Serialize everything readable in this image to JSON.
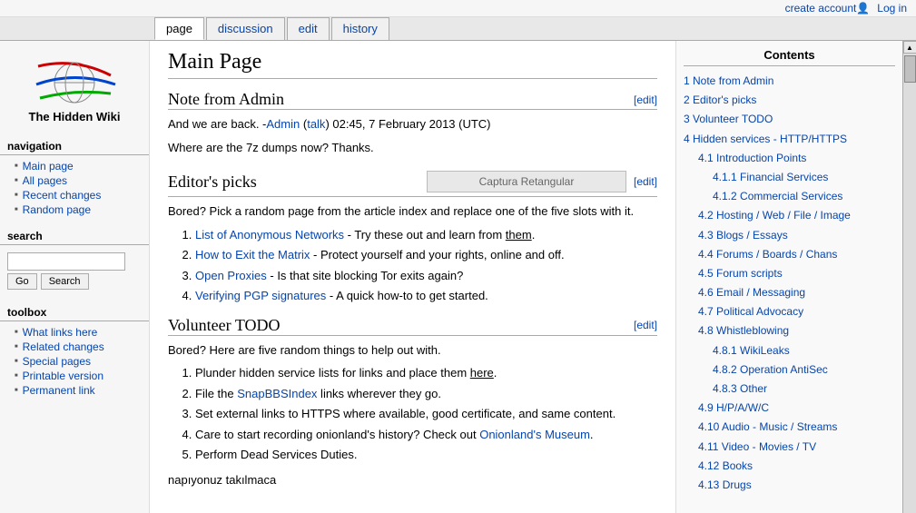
{
  "topbar": {
    "create_account": "create account",
    "login": "Log in"
  },
  "tabs": [
    {
      "id": "page",
      "label": "page",
      "active": true
    },
    {
      "id": "discussion",
      "label": "discussion",
      "active": false
    },
    {
      "id": "edit",
      "label": "edit",
      "active": false
    },
    {
      "id": "history",
      "label": "history",
      "active": false
    }
  ],
  "sidebar": {
    "logo_line1": "The Hidden Wiki",
    "nav_title": "navigation",
    "nav_links": [
      {
        "label": "Main page"
      },
      {
        "label": "All pages"
      },
      {
        "label": "Recent changes"
      },
      {
        "label": "Random page"
      }
    ],
    "search_title": "search",
    "search_placeholder": "",
    "go_label": "Go",
    "search_label": "Search",
    "toolbox_title": "toolbox",
    "toolbox_links": [
      {
        "label": "What links here"
      },
      {
        "label": "Related changes"
      },
      {
        "label": "Special pages"
      },
      {
        "label": "Printable version"
      },
      {
        "label": "Permanent link"
      }
    ]
  },
  "page": {
    "title": "Main Page",
    "sections": {
      "note_from_admin": {
        "heading": "Note from Admin",
        "edit_label": "[edit]",
        "body_line1": "And we are back. -Admin (talk) 02:45, 7 February 2013 (UTC)",
        "body_line2": "Where are the 7z dumps now? Thanks."
      },
      "editors_picks": {
        "heading": "Editor's picks",
        "edit_label": "[edit]",
        "capture_label": "Captura Retangular",
        "intro": "Bored? Pick a random page from the article index and replace one of the five slots with it.",
        "items": [
          {
            "text": "List of Anonymous Networks",
            "link": true,
            "suffix": " - Try these out and learn from them."
          },
          {
            "text": "How to Exit the Matrix",
            "link": true,
            "suffix": " - Protect yourself and your rights, online and off."
          },
          {
            "text": "Open Proxies",
            "link": true,
            "suffix": " - Is that site blocking Tor exits again?"
          },
          {
            "text": "Verifying PGP signatures",
            "link": true,
            "suffix": " - A quick how-to to get started."
          }
        ]
      },
      "volunteer_todo": {
        "heading": "Volunteer TODO",
        "edit_label": "[edit]",
        "intro": "Bored? Here are five random things to help out with.",
        "items": [
          {
            "text": "Plunder hidden service lists for links and place them here."
          },
          {
            "text": "File the ",
            "link_text": "SnapBBSIndex",
            "suffix": " links wherever they go."
          },
          {
            "text": "Set external links to HTTPS where available, good certificate, and same content."
          },
          {
            "text": "Care to start recording onionland's history? Check out ",
            "link_text": "Onionland's Museum",
            "suffix": "."
          },
          {
            "text": "Perform Dead Services Duties."
          }
        ]
      },
      "footer_text": "napıyonuz takılmaca"
    }
  },
  "toc": {
    "title": "Contents",
    "items": [
      {
        "num": "1",
        "label": "Note from Admin",
        "indent": 0
      },
      {
        "num": "2",
        "label": "Editor's picks",
        "indent": 0
      },
      {
        "num": "3",
        "label": "Volunteer TODO",
        "indent": 0
      },
      {
        "num": "4",
        "label": "Hidden services - HTTP/HTTPS",
        "indent": 0
      },
      {
        "num": "4.1",
        "label": "Introduction Points",
        "indent": 1
      },
      {
        "num": "4.1.1",
        "label": "Financial Services",
        "indent": 2
      },
      {
        "num": "4.1.2",
        "label": "Commercial Services",
        "indent": 2
      },
      {
        "num": "4.2",
        "label": "Hosting / Web / File / Image",
        "indent": 1
      },
      {
        "num": "4.3",
        "label": "Blogs / Essays",
        "indent": 1
      },
      {
        "num": "4.4",
        "label": "Forums / Boards / Chans",
        "indent": 1
      },
      {
        "num": "4.5",
        "label": "Forum scripts",
        "indent": 1
      },
      {
        "num": "4.6",
        "label": "Email / Messaging",
        "indent": 1
      },
      {
        "num": "4.7",
        "label": "Political Advocacy",
        "indent": 1
      },
      {
        "num": "4.8",
        "label": "Whistleblowing",
        "indent": 1
      },
      {
        "num": "4.8.1",
        "label": "WikiLeaks",
        "indent": 2
      },
      {
        "num": "4.8.2",
        "label": "Operation AntiSec",
        "indent": 2
      },
      {
        "num": "4.8.3",
        "label": "Other",
        "indent": 2
      },
      {
        "num": "4.9",
        "label": "H/P/A/W/C",
        "indent": 1
      },
      {
        "num": "4.10",
        "label": "Audio - Music / Streams",
        "indent": 1
      },
      {
        "num": "4.11",
        "label": "Video - Movies / TV",
        "indent": 1
      },
      {
        "num": "4.12",
        "label": "Books",
        "indent": 1
      },
      {
        "num": "4.13",
        "label": "Drugs",
        "indent": 1
      }
    ]
  }
}
